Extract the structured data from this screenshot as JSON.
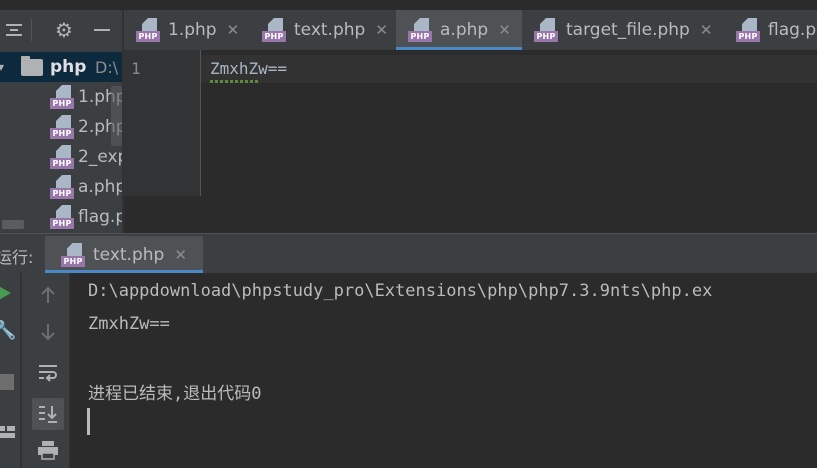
{
  "editor": {
    "tabs": [
      {
        "label": "1.php"
      },
      {
        "label": "text.php"
      },
      {
        "label": "a.php"
      },
      {
        "label": "target_file.php"
      },
      {
        "label": "flag.ph"
      }
    ],
    "line_numbers": [
      "1"
    ],
    "code_lines": [
      "ZmxhZw=="
    ]
  },
  "project": {
    "root": {
      "name": "php",
      "path": "D:\\"
    },
    "items": [
      "1.php",
      "2.php",
      "2_exp",
      "a.php",
      "flag.p"
    ]
  },
  "run": {
    "label": "运行:",
    "tab_label": "text.php",
    "output": [
      "D:\\appdownload\\phpstudy_pro\\Extensions\\php\\php7.3.9nts\\php.ex",
      "ZmxhZw==",
      "",
      "进程已结束,退出代码0"
    ]
  },
  "icons": {
    "php_file": "php-file-icon",
    "folder": "folder-icon",
    "close": "close-icon",
    "gear": "gear-icon",
    "run": "run-icon",
    "wrench": "wrench-icon",
    "stop": "stop-icon",
    "arrow_up": "arrow-up-icon",
    "arrow_down": "arrow-down-icon",
    "soft_wrap": "soft-wrap-icon",
    "scroll_to_end": "scroll-to-end-icon",
    "print": "print-icon",
    "layout": "layout-icon"
  },
  "colors": {
    "accent": "#4a88c7",
    "php_badge": "#9876aa",
    "run_green": "#499c54",
    "selection": "#0d293e"
  }
}
